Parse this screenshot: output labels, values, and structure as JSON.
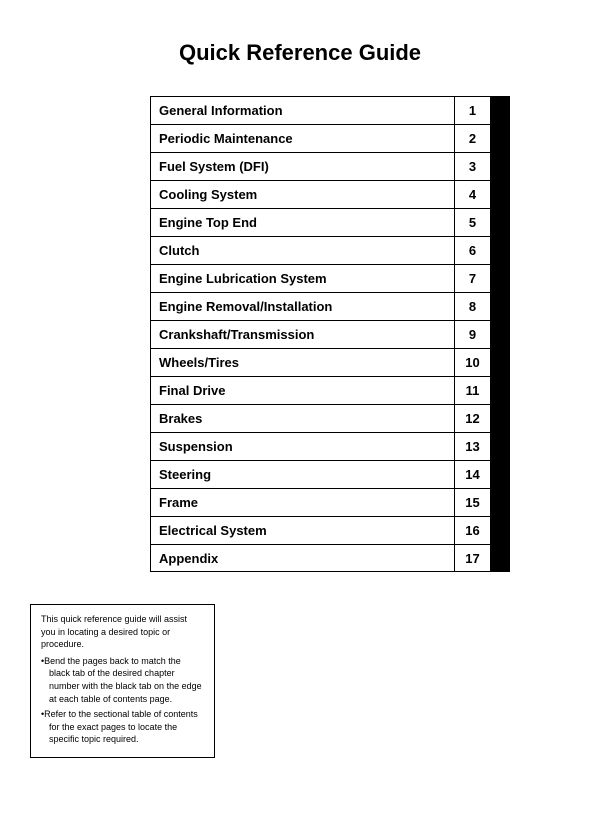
{
  "title": "Quick Reference Guide",
  "toc_items": [
    {
      "label": "General Information",
      "number": "1"
    },
    {
      "label": "Periodic Maintenance",
      "number": "2"
    },
    {
      "label": "Fuel System (DFI)",
      "number": "3"
    },
    {
      "label": "Cooling System",
      "number": "4"
    },
    {
      "label": "Engine Top End",
      "number": "5"
    },
    {
      "label": "Clutch",
      "number": "6"
    },
    {
      "label": "Engine Lubrication System",
      "number": "7"
    },
    {
      "label": "Engine Removal/Installation",
      "number": "8"
    },
    {
      "label": "Crankshaft/Transmission",
      "number": "9"
    },
    {
      "label": "Wheels/Tires",
      "number": "10"
    },
    {
      "label": "Final Drive",
      "number": "11"
    },
    {
      "label": "Brakes",
      "number": "12"
    },
    {
      "label": "Suspension",
      "number": "13"
    },
    {
      "label": "Steering",
      "number": "14"
    },
    {
      "label": "Frame",
      "number": "15"
    },
    {
      "label": "Electrical System",
      "number": "16"
    },
    {
      "label": "Appendix",
      "number": "17"
    }
  ],
  "note": {
    "intro": "This quick reference guide will assist you in locating a desired topic or procedure.",
    "bullet1": "•Bend the pages back to match the black tab of the desired chapter number with the black tab on the edge at each table of contents page.",
    "bullet2": "•Refer to the sectional table of contents for the exact pages to locate the specific topic required."
  }
}
